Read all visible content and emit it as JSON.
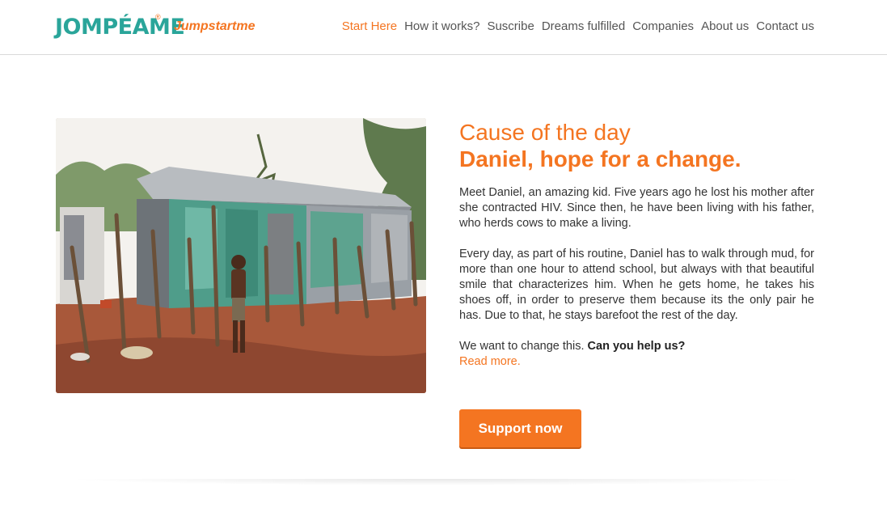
{
  "brand": {
    "logo_text": "JOMPÉAME",
    "registered_mark": "®",
    "tagline": "Jumpstartme",
    "logo_color": "#2aa59a",
    "accent_color": "#f47521"
  },
  "nav": {
    "items": [
      {
        "label": "Start Here",
        "active": true
      },
      {
        "label": "How it works?",
        "active": false
      },
      {
        "label": "Suscribe",
        "active": false
      },
      {
        "label": "Dreams fulfilled",
        "active": false
      },
      {
        "label": "Companies",
        "active": false
      },
      {
        "label": "About us",
        "active": false
      },
      {
        "label": "Contact us",
        "active": false
      }
    ]
  },
  "cause": {
    "heading": "Cause of the day",
    "title": "Daniel, hope for a change.",
    "paragraph1": "Meet Daniel, an amazing kid. Five years ago he lost his mother after she contracted HIV. Since then, he have been living with his father, who herds cows to make a living.",
    "paragraph2": "Every day, as part of his routine, Daniel has to walk through mud, for more than one hour to attend school, but always with that beautiful smile that characterizes him. When he gets home, he takes his shoes off, in order to preserve them because its the only pair he has. Due to that, he stays barefoot the rest of the day.",
    "paragraph3_text": "We want to change this.",
    "paragraph3_bold": "Can you help us?",
    "read_more": "Read more.",
    "button_label": "Support now"
  }
}
